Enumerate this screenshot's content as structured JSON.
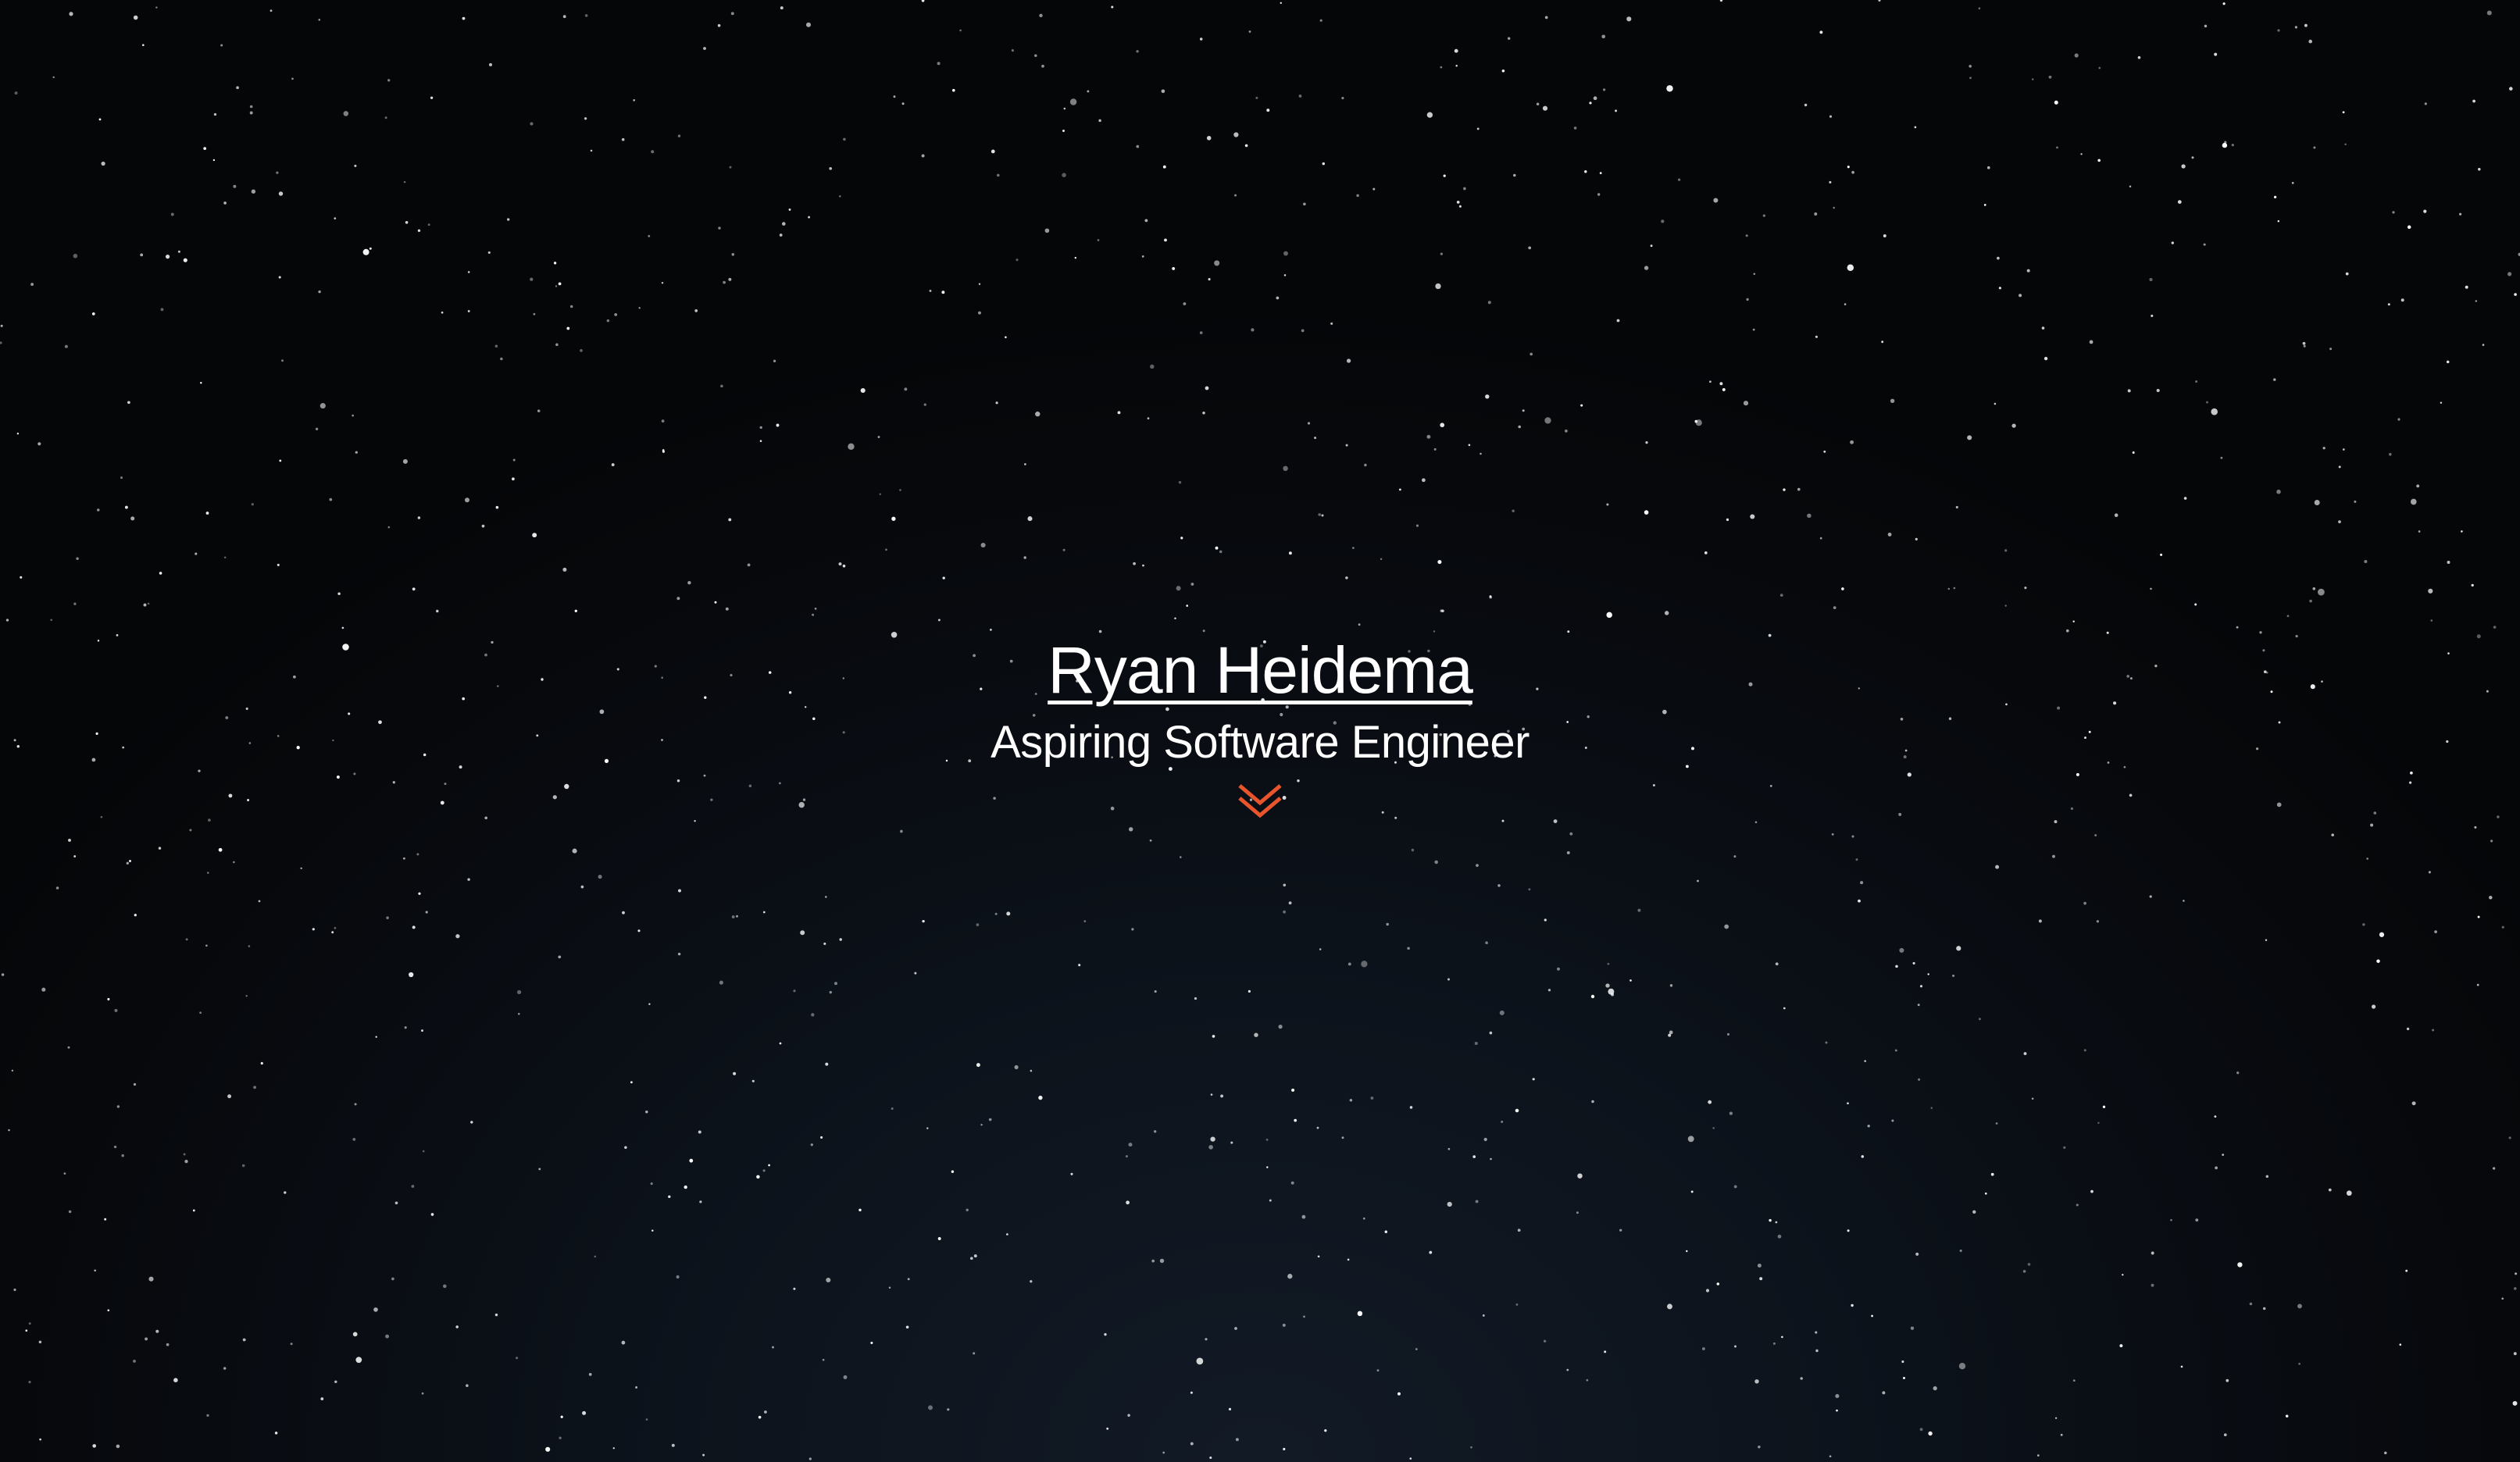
{
  "hero": {
    "name": "Ryan Heidema",
    "tagline": "Aspiring Software Engineer",
    "scroll_icon": "double-chevron-down-icon"
  },
  "colors": {
    "background_top": "#050608",
    "background_bottom": "#121a26",
    "text": "#ffffff",
    "accent": "#e8552c",
    "stars": "#ffffff"
  }
}
